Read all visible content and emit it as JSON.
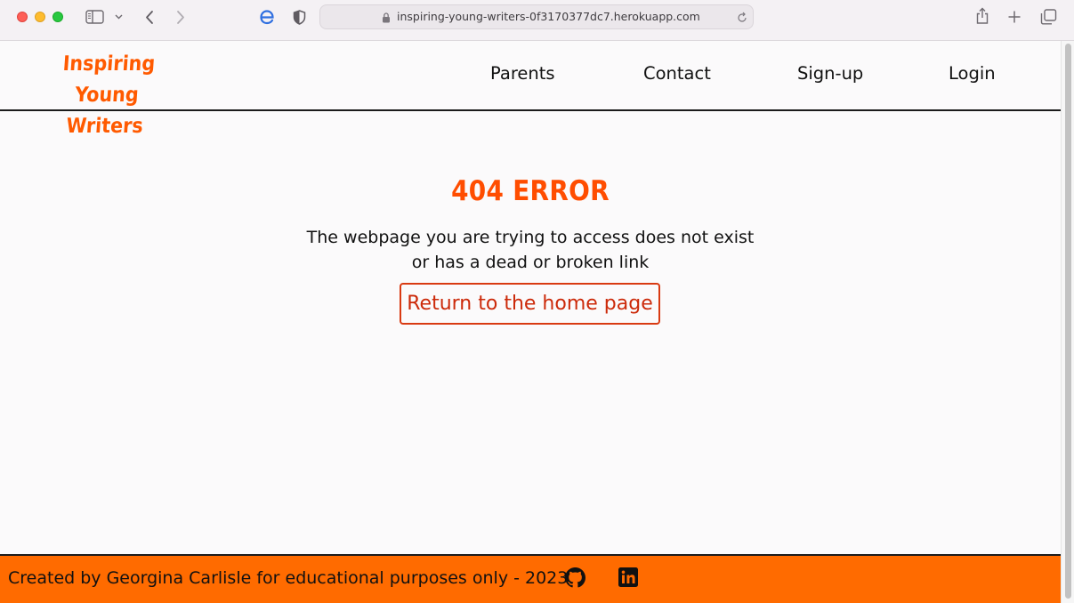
{
  "browser": {
    "url": "inspiring-young-writers-0f3170377dc7.herokuapp.com",
    "icons": [
      "red-close-light",
      "yellow-minimize-light",
      "green-zoom-light",
      "sidebar-icon",
      "chevron-down-icon",
      "back-icon",
      "forward-icon",
      "extension-e-icon",
      "shield-icon",
      "lock-icon",
      "reload-icon",
      "share-icon",
      "new-tab-plus-icon",
      "tabs-overview-icon"
    ]
  },
  "header": {
    "logo_line1": "Inspiring Young",
    "logo_line2": "Writers",
    "nav": [
      {
        "label": "Parents"
      },
      {
        "label": "Contact"
      },
      {
        "label": "Sign-up"
      },
      {
        "label": "Login"
      }
    ]
  },
  "main": {
    "title": "404 ERROR",
    "message_line1": "The webpage you are trying to access does not exist",
    "message_line2": "or has a dead or broken link",
    "button_label": "Return to the home page"
  },
  "footer": {
    "text": "Created by Georgina Carlisle for educational purposes only - 2023",
    "icons": [
      "github-icon",
      "linkedin-icon"
    ]
  },
  "colors": {
    "accent": "#ff5a00",
    "footer_bg": "#ff6b00",
    "button_border": "#d93a12"
  }
}
